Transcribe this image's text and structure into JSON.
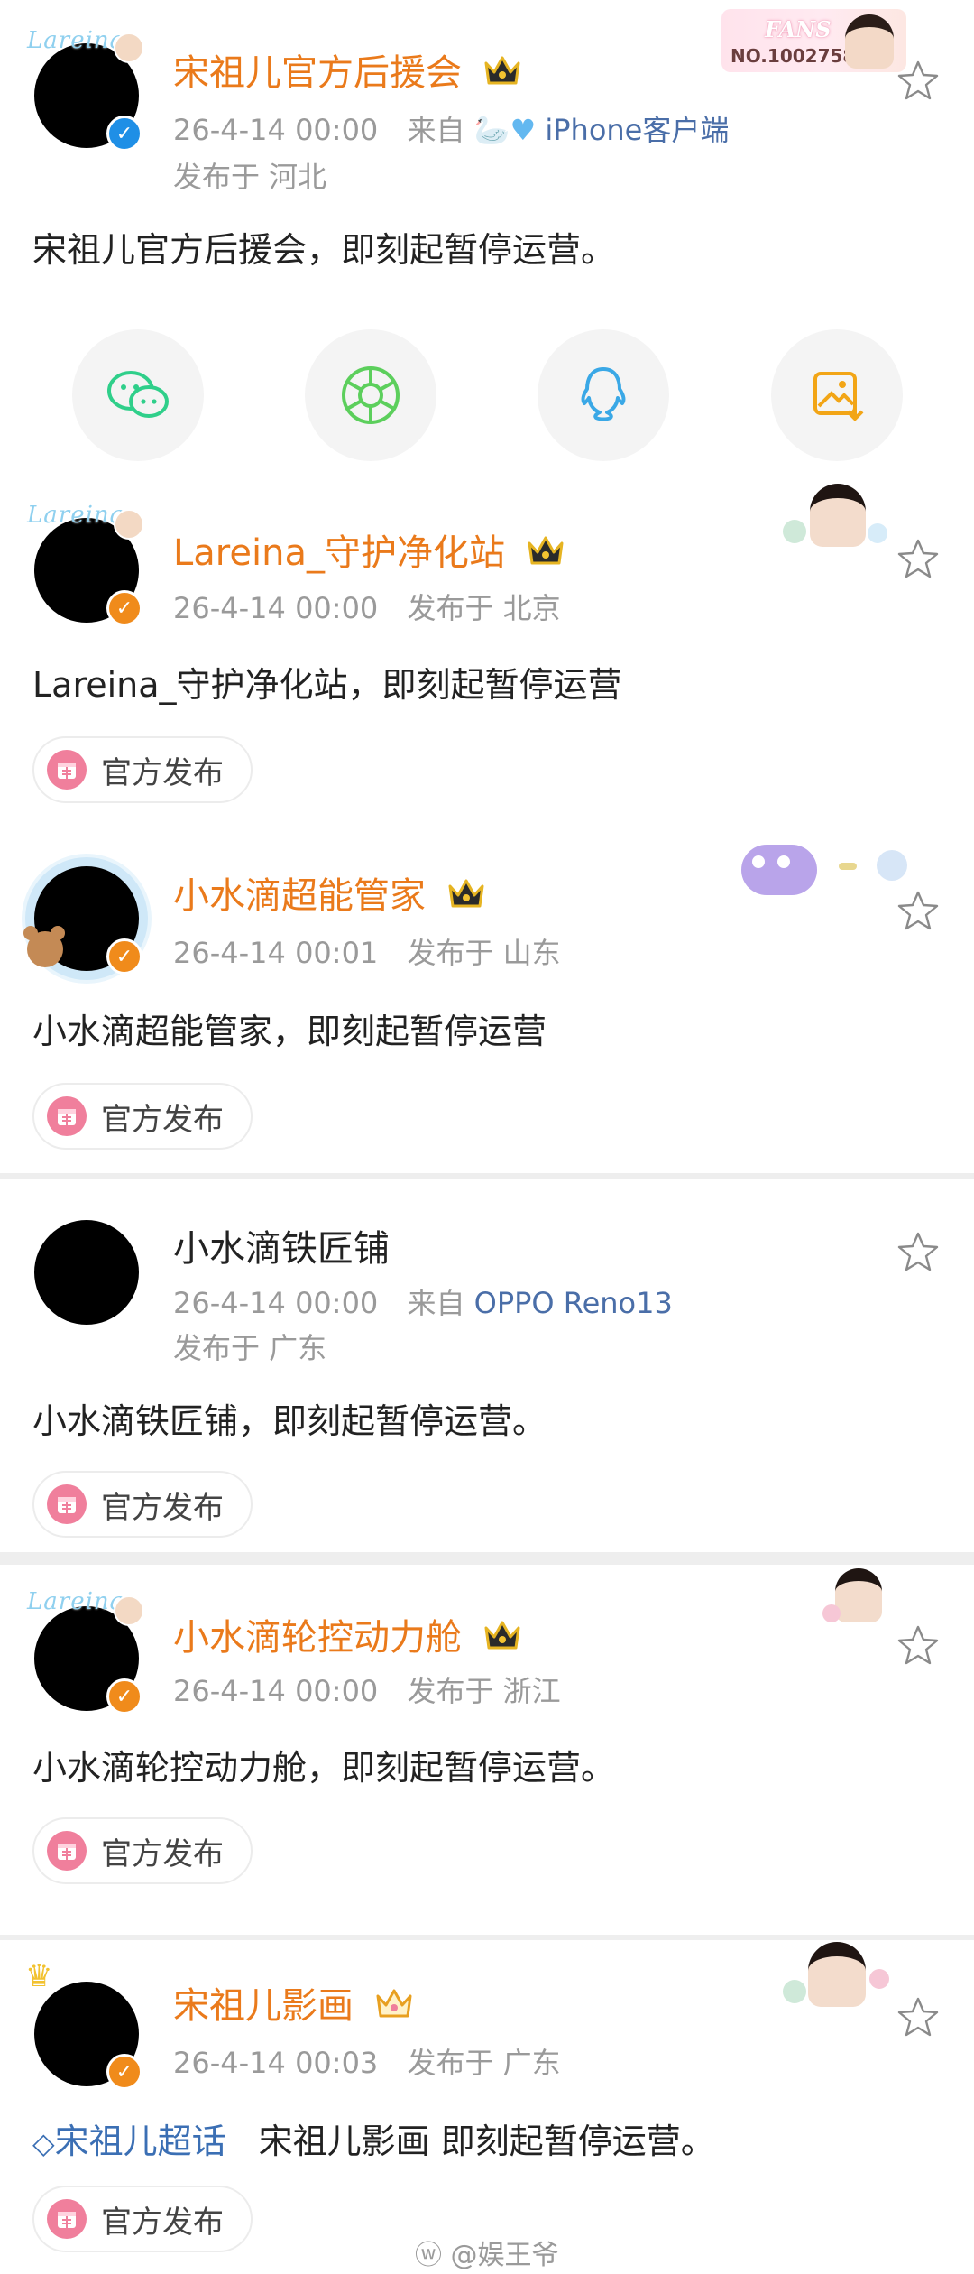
{
  "posts": [
    {
      "name": "宋祖儿官方后援会",
      "avatar_ring_text": "Lareina",
      "time": "26-4-14 00:00",
      "source_prefix": "来自",
      "device": "iPhone客户端",
      "location": "发布于 河北",
      "content": "宋祖儿官方后援会，即刻起暂停运营。",
      "fans_card": {
        "title": "FANS",
        "number": "NO.1002758"
      }
    },
    {
      "name": "Lareina_守护净化站",
      "avatar_ring_text": "Lareina",
      "time": "26-4-14 00:00",
      "location": "发布于 北京",
      "content": "Lareina_守护净化站，即刻起暂停运营",
      "tag": "官方发布"
    },
    {
      "name": "小水滴超能管家",
      "time": "26-4-14 00:01",
      "location": "发布于 山东",
      "content": "小水滴超能管家，即刻起暂停运营",
      "tag": "官方发布"
    },
    {
      "name": "小水滴铁匠铺",
      "time": "26-4-14 00:00",
      "source_prefix": "来自",
      "device": "OPPO Reno13",
      "location": "发布于 广东",
      "content": "小水滴铁匠铺，即刻起暂停运营。",
      "tag": "官方发布"
    },
    {
      "name": "小水滴轮控动力舱",
      "avatar_ring_text": "Lareina",
      "time": "26-4-14 00:00",
      "location": "发布于 浙江",
      "content": "小水滴轮控动力舱，即刻起暂停运营。",
      "tag": "官方发布"
    },
    {
      "name": "宋祖儿影画",
      "time": "26-4-14 00:03",
      "location": "发布于 广东",
      "topic": "宋祖儿超话",
      "content": "宋祖儿影画 即刻起暂停运营。",
      "tag": "官方发布"
    }
  ],
  "share_icons": [
    "wechat-icon",
    "moments-icon",
    "qq-icon",
    "save-image-icon"
  ],
  "watermark": "@娱王爷",
  "colors": {
    "name_orange": "#ea7a1b",
    "link_blue": "#3b6fb4",
    "meta_gray": "#9a9a9a",
    "tag_pink": "#f07f9c"
  }
}
